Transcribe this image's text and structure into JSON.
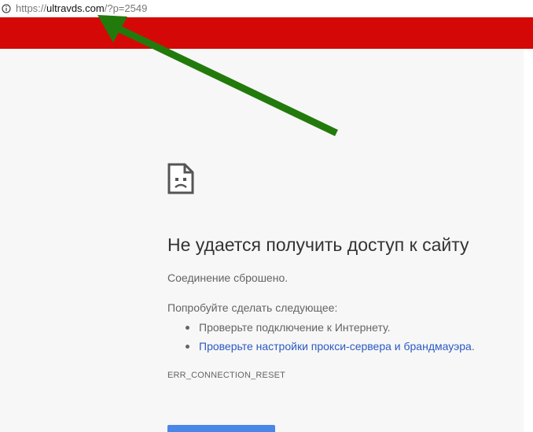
{
  "address_bar": {
    "url_scheme": "https://",
    "url_host": "ultravds.com",
    "url_query": "/?p=2549",
    "info_icon": "info-icon"
  },
  "error_page": {
    "icon": "sad-document-icon",
    "title": "Не удается получить доступ к сайту",
    "subtitle": "Соединение сброшено.",
    "suggestions_heading": "Попробуйте сделать следующее:",
    "suggestions": [
      {
        "text": "Проверьте подключение к Интернету.",
        "link_text": "",
        "suffix": ""
      },
      {
        "text": "",
        "link_text": "Проверьте настройки прокси-сервера и брандмауэра",
        "suffix": "."
      }
    ],
    "error_code": "ERR_CONNECTION_RESET",
    "reload_button_label": ""
  },
  "colors": {
    "banner_red": "#d50808",
    "page_background": "#f7f7f7",
    "link_blue": "#2b59c3",
    "button_blue": "#4a86e8",
    "annotation_green": "#237a0c"
  },
  "annotation": {
    "arrow_icon": "green-arrow-icon"
  }
}
